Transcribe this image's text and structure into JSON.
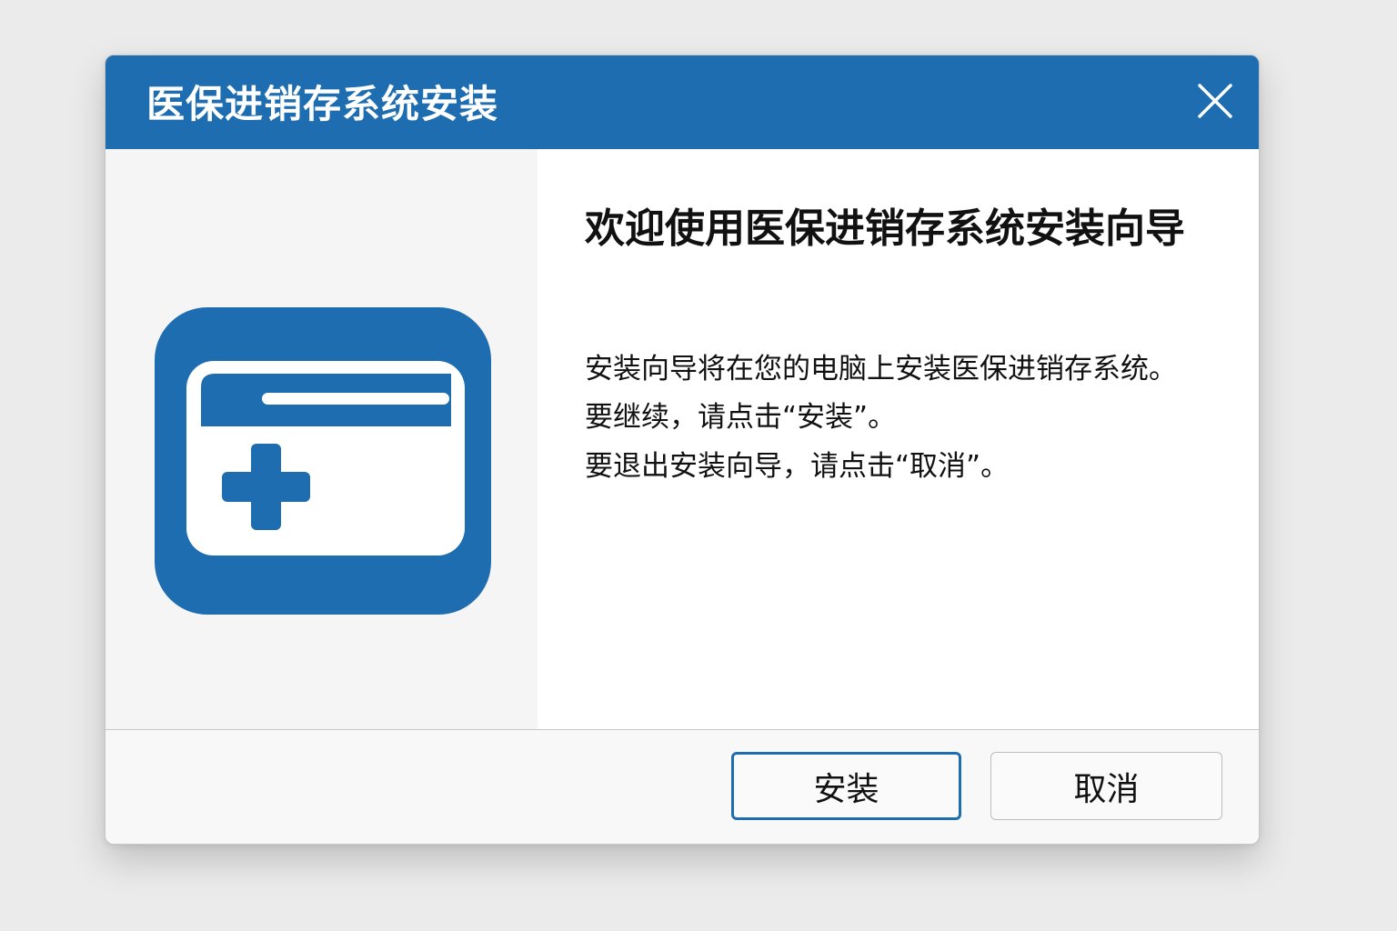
{
  "window": {
    "title": "医保进销存系统安装",
    "close_icon": "close-icon"
  },
  "sidebar": {
    "icon": "medical-card-icon",
    "icon_color": "#1f6db1"
  },
  "main": {
    "heading": "欢迎使用医保进销存系统安装向导",
    "lines": [
      "安装向导将在您的电脑上安装医保进销存系统。",
      "要继续，请点击“安装”。",
      "要退出安装向导，请点击“取消”。"
    ]
  },
  "footer": {
    "install_label": "安装",
    "cancel_label": "取消"
  },
  "colors": {
    "accent": "#1f6db1",
    "background": "#ebebeb",
    "panel": "#f5f5f5"
  }
}
